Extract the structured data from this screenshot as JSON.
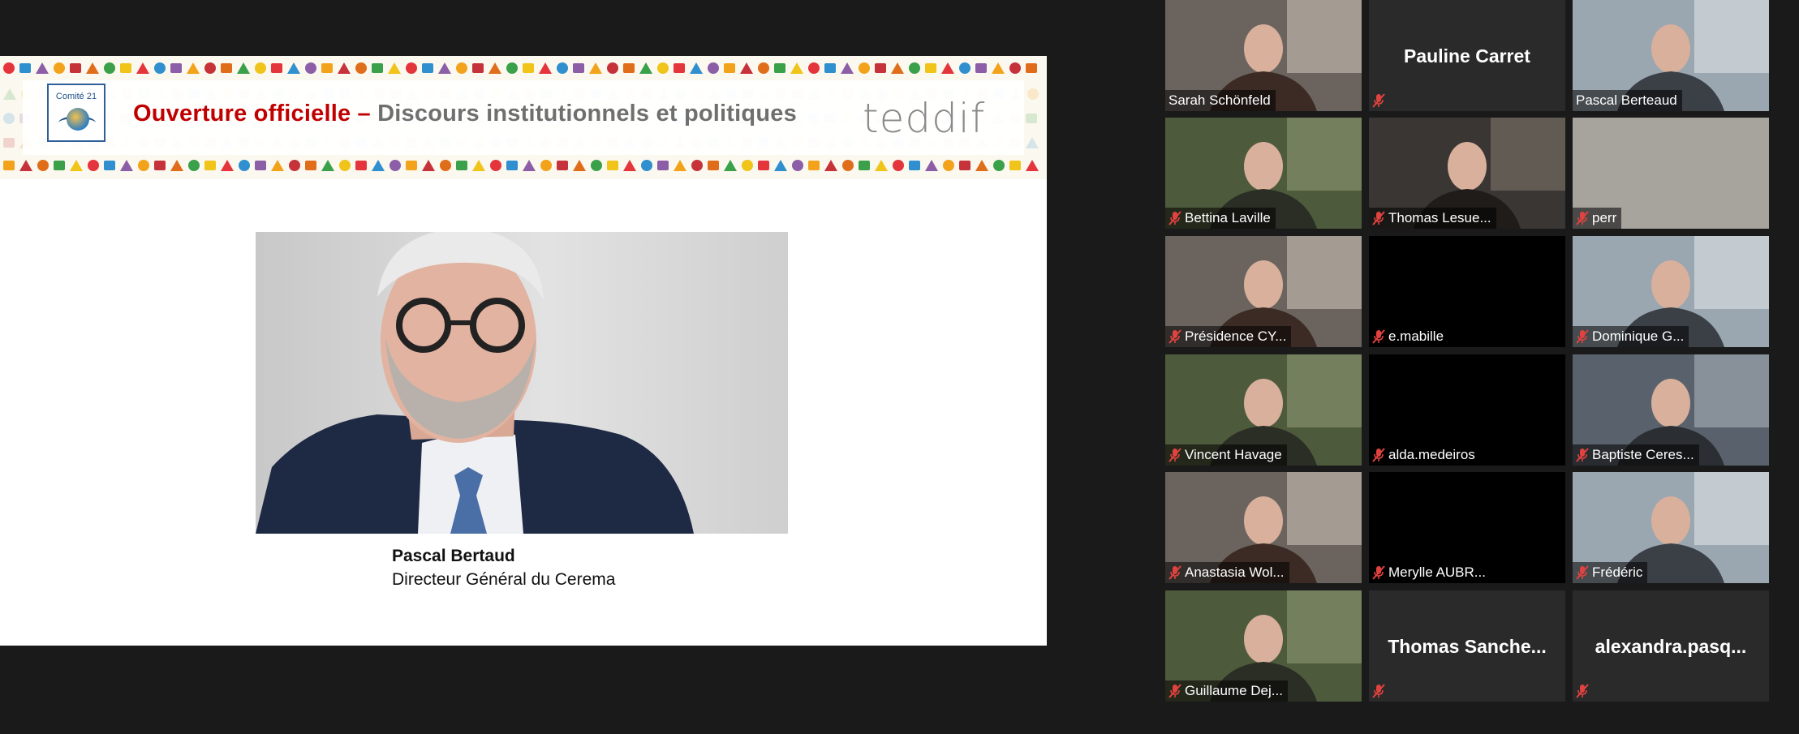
{
  "slide": {
    "logo_text": "Comité 21",
    "title_part1": "Ouverture officielle –",
    "title_part2": " Discours institutionnels et politiques",
    "brand": "teddif",
    "speaker_name": "Pascal Bertaud",
    "speaker_title": "Directeur Général du Cerema"
  },
  "participants": [
    {
      "name": "Sarah Schönfeld",
      "muted": false,
      "display": "video"
    },
    {
      "name": "Pauline Carret",
      "muted": true,
      "display": "name"
    },
    {
      "name": "Pascal Berteaud",
      "muted": false,
      "display": "video",
      "active": true
    },
    {
      "name": "Bettina Laville",
      "muted": true,
      "display": "video"
    },
    {
      "name": "Thomas Lesue...",
      "muted": true,
      "display": "video"
    },
    {
      "name": "perr",
      "muted": true,
      "display": "blank"
    },
    {
      "name": "Présidence CY...",
      "muted": true,
      "display": "video"
    },
    {
      "name": "e.mabille",
      "muted": true,
      "display": "black"
    },
    {
      "name": "Dominique G...",
      "muted": true,
      "display": "video"
    },
    {
      "name": "Vincent Havage",
      "muted": true,
      "display": "video"
    },
    {
      "name": "alda.medeiros",
      "muted": true,
      "display": "black"
    },
    {
      "name": "Baptiste Ceres...",
      "muted": true,
      "display": "video"
    },
    {
      "name": "Anastasia Wol...",
      "muted": true,
      "display": "video"
    },
    {
      "name": "Merylle AUBR...",
      "muted": true,
      "display": "black"
    },
    {
      "name": "Frédéric",
      "muted": true,
      "display": "video"
    },
    {
      "name": "Guillaume Dej...",
      "muted": true,
      "display": "video"
    },
    {
      "name": "Thomas  Sanche...",
      "muted": true,
      "display": "name"
    },
    {
      "name": "alexandra.pasq...",
      "muted": true,
      "display": "name"
    }
  ],
  "colors": {
    "background": "#1a1a1a",
    "tile": "#2a2a2a",
    "active_speaker": "#e2e36a",
    "muted_icon": "#e0423f",
    "title_red": "#c00000"
  },
  "icons": {
    "muted": "microphone-muted-icon"
  }
}
